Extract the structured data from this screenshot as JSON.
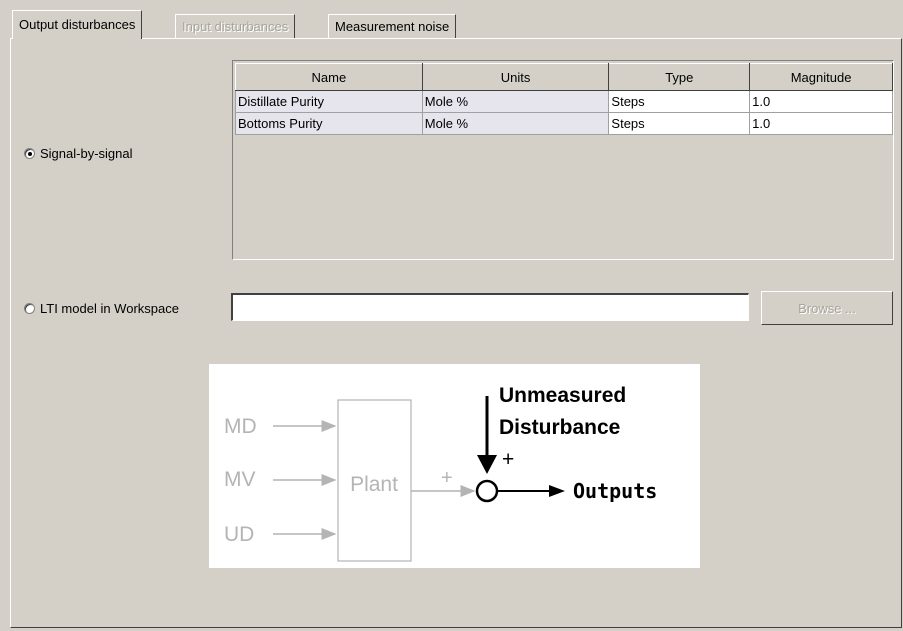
{
  "tabs": [
    {
      "label": "Output disturbances",
      "state": "active"
    },
    {
      "label": "Input disturbances",
      "state": "disabled"
    },
    {
      "label": "Measurement noise",
      "state": "normal"
    }
  ],
  "signal_radio": {
    "label": "Signal-by-signal",
    "selected": true
  },
  "lti_radio": {
    "label": "LTI model in Workspace",
    "selected": false
  },
  "table": {
    "columns": [
      "Name",
      "Units",
      "Type",
      "Magnitude"
    ],
    "rows": [
      [
        "Distillate Purity",
        "Mole %",
        "Steps",
        "1.0"
      ],
      [
        "Bottoms Purity",
        "Mole %",
        "Steps",
        "1.0"
      ]
    ]
  },
  "workspace_input": {
    "value": ""
  },
  "browse_button": {
    "label": "Browse ...",
    "enabled": false
  },
  "diagram": {
    "inputs": [
      "MD",
      "MV",
      "UD"
    ],
    "plant_label": "Plant",
    "plus_left": "+",
    "plus_top": "+",
    "disturbance_line1": "Unmeasured",
    "disturbance_line2": "Disturbance",
    "output_label": "Outputs"
  },
  "colors": {
    "background": "#d4d0c8",
    "disabled_text": "#a8a49c",
    "diagram_gray": "#b4b4b4"
  }
}
